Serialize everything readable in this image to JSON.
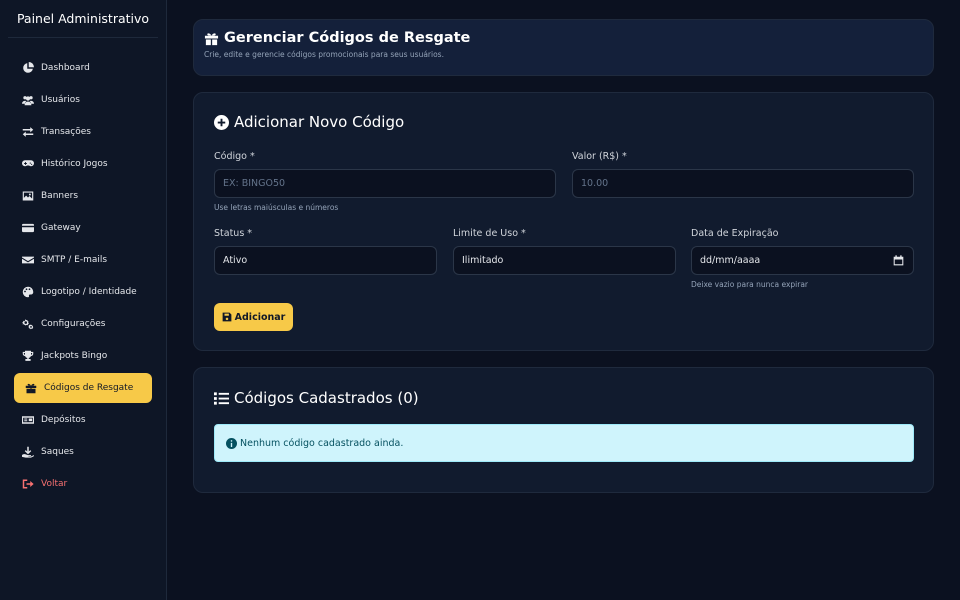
{
  "sidebar": {
    "brand": "Painel Administrativo",
    "items": [
      {
        "label": "Dashboard",
        "icon": "chart-pie-icon"
      },
      {
        "label": "Usuários",
        "icon": "users-icon"
      },
      {
        "label": "Transações",
        "icon": "exchange-icon"
      },
      {
        "label": "Histórico Jogos",
        "icon": "gamepad-icon"
      },
      {
        "label": "Banners",
        "icon": "images-icon"
      },
      {
        "label": "Gateway",
        "icon": "credit-card-icon"
      },
      {
        "label": "SMTP / E-mails",
        "icon": "envelope-icon"
      },
      {
        "label": "Logotipo / Identidade",
        "icon": "palette-icon"
      },
      {
        "label": "Configurações",
        "icon": "cogs-icon"
      },
      {
        "label": "Jackpots Bingo",
        "icon": "trophy-icon"
      },
      {
        "label": "Códigos de Resgate",
        "icon": "gift-icon",
        "active": true
      },
      {
        "label": "Depósitos",
        "icon": "id-card-icon"
      },
      {
        "label": "Saques",
        "icon": "hand-holding-icon"
      },
      {
        "label": "Voltar",
        "icon": "sign-out-icon"
      }
    ]
  },
  "header": {
    "title": "Gerenciar Códigos de Resgate",
    "subtitle": "Crie, edite e gerencie códigos promocionais para seus usuários."
  },
  "form": {
    "title": "Adicionar Novo Código",
    "code_label": "Código *",
    "code_placeholder": "EX: BINGO50",
    "code_help": "Use letras maiúsculas e números",
    "value_label": "Valor (R$) *",
    "value_placeholder": "10.00",
    "status_label": "Status *",
    "status_value": "Ativo",
    "limit_label": "Limite de Uso *",
    "limit_value": "Ilimitado",
    "expiry_label": "Data de Expiração",
    "expiry_value": "dd/mm/aaaa",
    "expiry_help": "Deixe vazio para nunca expirar",
    "submit_label": "Adicionar"
  },
  "list": {
    "title": "Códigos Cadastrados (0)",
    "empty_message": "Nenhum código cadastrado ainda."
  },
  "colors": {
    "accent": "#f7c948",
    "background": "#0b1120",
    "card": "#111b2e",
    "danger": "#f87171",
    "info_bg": "#cff4fc",
    "info_text": "#055160"
  }
}
